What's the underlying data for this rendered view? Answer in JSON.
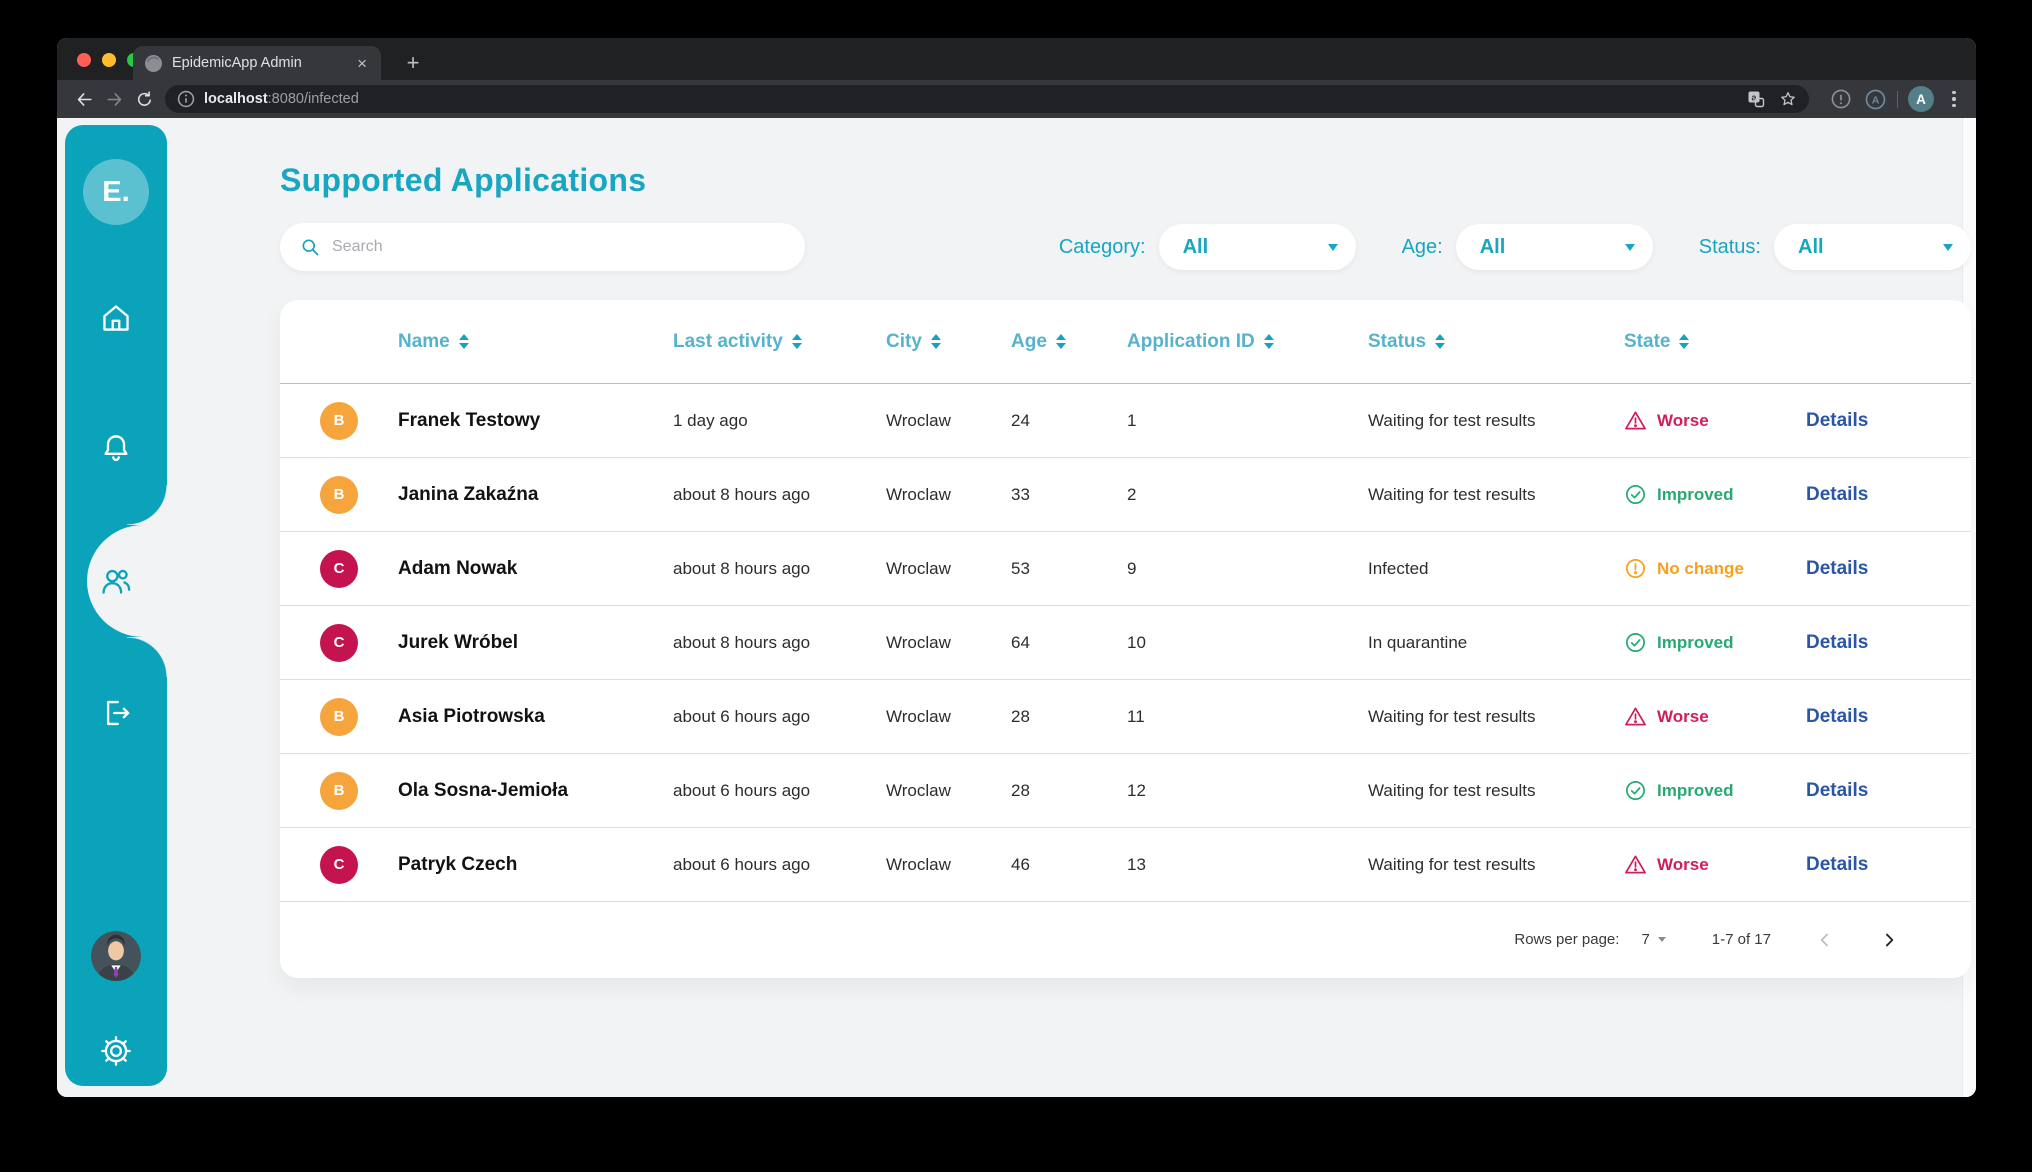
{
  "browser": {
    "tab_title": "EpidemicApp Admin",
    "tab_close_label": "×",
    "new_tab_label": "+",
    "url_host": "localhost",
    "url_path": ":8080/infected",
    "extension_initial": "A",
    "profile_initial": "A"
  },
  "sidebar": {
    "logo_text": "E."
  },
  "page": {
    "title": "Supported Applications",
    "search_placeholder": "Search",
    "filters": [
      {
        "label": "Category:",
        "value": "All"
      },
      {
        "label": "Age:",
        "value": "All"
      },
      {
        "label": "Status:",
        "value": "All"
      }
    ]
  },
  "table": {
    "columns": [
      "Name",
      "Last activity",
      "City",
      "Age",
      "Application ID",
      "Status",
      "State"
    ],
    "details_label": "Details",
    "rows": [
      {
        "initial": "B",
        "initial_color": "#f6a43c",
        "name": "Franek Testowy",
        "last_activity": "1 day ago",
        "city": "Wroclaw",
        "age": "24",
        "application_id": "1",
        "status": "Waiting for test results",
        "state": "Worse",
        "state_type": "worse"
      },
      {
        "initial": "B",
        "initial_color": "#f6a43c",
        "name": "Janina Zakaźna",
        "last_activity": "about 8 hours ago",
        "city": "Wroclaw",
        "age": "33",
        "application_id": "2",
        "status": "Waiting for test results",
        "state": "Improved",
        "state_type": "improved"
      },
      {
        "initial": "C",
        "initial_color": "#c5134f",
        "name": "Adam Nowak",
        "last_activity": "about 8 hours ago",
        "city": "Wroclaw",
        "age": "53",
        "application_id": "9",
        "status": "Infected",
        "state": "No change",
        "state_type": "nochange"
      },
      {
        "initial": "C",
        "initial_color": "#c5134f",
        "name": "Jurek Wróbel",
        "last_activity": "about 8 hours ago",
        "city": "Wroclaw",
        "age": "64",
        "application_id": "10",
        "status": "In quarantine",
        "state": "Improved",
        "state_type": "improved"
      },
      {
        "initial": "B",
        "initial_color": "#f6a43c",
        "name": "Asia Piotrowska",
        "last_activity": "about 6 hours ago",
        "city": "Wroclaw",
        "age": "28",
        "application_id": "11",
        "status": "Waiting for test results",
        "state": "Worse",
        "state_type": "worse"
      },
      {
        "initial": "B",
        "initial_color": "#f6a43c",
        "name": "Ola Sosna-Jemioła",
        "last_activity": "about 6 hours ago",
        "city": "Wroclaw",
        "age": "28",
        "application_id": "12",
        "status": "Waiting for test results",
        "state": "Improved",
        "state_type": "improved"
      },
      {
        "initial": "C",
        "initial_color": "#c5134f",
        "name": "Patryk Czech",
        "last_activity": "about 6 hours ago",
        "city": "Wroclaw",
        "age": "46",
        "application_id": "13",
        "status": "Waiting for test results",
        "state": "Worse",
        "state_type": "worse"
      }
    ],
    "pagination": {
      "rows_per_page_label": "Rows per page:",
      "rows_per_page": "7",
      "range": "1-7 of 17"
    }
  },
  "colors": {
    "accent_teal": "#0ba3b9",
    "title_text": "#18a6c2",
    "table_header_text": "#56b3cb",
    "worse": "#d31c5b",
    "improved": "#28a971",
    "no_change": "#f9a01b",
    "details_link": "#2b55a7",
    "badge_orange": "#f6a43c",
    "badge_crimson": "#c5134f"
  }
}
